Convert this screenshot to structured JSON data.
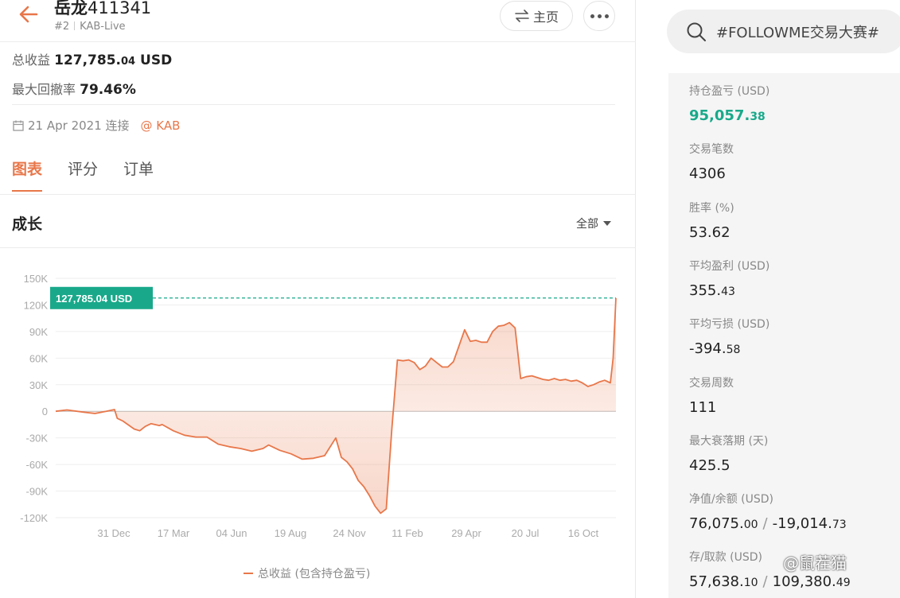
{
  "header": {
    "title_name": "岳龙",
    "title_num": "411341",
    "rank": "#2",
    "account_type": "KAB-Live",
    "home_label": "主页",
    "home_icon": "swap-arrows-icon",
    "more_icon": "more-dots-icon",
    "back_icon": "back-arrow-icon"
  },
  "summary": {
    "total_profit_label": "总收益",
    "total_profit_main": "127,785.",
    "total_profit_decimal": "04",
    "total_profit_unit": "USD",
    "max_drawdown_label": "最大回撤率",
    "max_drawdown_value": "79.46%",
    "connected_date": "21 Apr 2021 连接",
    "broker": "@ KAB",
    "calendar_icon": "calendar-icon"
  },
  "tabs": [
    {
      "label": "图表",
      "active": true
    },
    {
      "label": "评分",
      "active": false
    },
    {
      "label": "订单",
      "active": false
    }
  ],
  "growth": {
    "title": "成长",
    "filter": "全部"
  },
  "chart_data": {
    "type": "area",
    "current_value_label": "127,785.04 USD",
    "current_value": 127785.04,
    "y_ticks": [
      "150K",
      "120K",
      "90K",
      "60K",
      "30K",
      "0",
      "-30K",
      "-60K",
      "-90K",
      "-120K"
    ],
    "y_tick_values": [
      150000,
      120000,
      90000,
      60000,
      30000,
      0,
      -30000,
      -60000,
      -90000,
      -120000
    ],
    "ylim": [
      -120000,
      150000
    ],
    "x_ticks": [
      "31 Dec",
      "17 Mar",
      "04 Jun",
      "19 Aug",
      "24 Nov",
      "11 Feb",
      "29 Apr",
      "20 Jul",
      "16 Oct"
    ],
    "xlim": [
      0,
      100
    ],
    "series": [
      {
        "name": "总收益 (包含持仓盈亏)",
        "color": "#e8774a",
        "x": [
          0,
          2,
          5,
          7,
          9,
          10.5,
          11,
          12,
          14,
          15,
          16,
          17,
          18.5,
          19,
          21,
          23,
          25,
          27,
          29,
          31,
          33,
          35,
          37,
          38,
          40,
          42,
          44,
          46,
          48,
          50,
          51,
          52,
          53,
          54,
          55,
          56,
          57,
          58,
          59,
          60,
          61,
          62,
          63,
          64,
          65,
          66,
          67,
          68,
          69,
          70,
          71,
          72,
          73,
          74,
          75,
          76,
          77,
          78,
          79,
          80,
          81,
          82,
          83,
          84,
          85,
          86,
          87,
          88,
          89,
          90,
          91,
          92,
          93,
          94,
          95,
          96,
          97,
          98,
          99,
          99.5,
          100
        ],
        "y": [
          0,
          1500,
          -1000,
          -2500,
          0,
          2000,
          -8000,
          -11000,
          -20000,
          -22000,
          -17000,
          -14000,
          -16000,
          -15000,
          -22000,
          -27000,
          -29000,
          -29000,
          -37000,
          -40000,
          -42000,
          -45000,
          -42000,
          -38000,
          -44000,
          -48000,
          -54000,
          -53000,
          -50000,
          -30000,
          -52000,
          -57000,
          -65000,
          -78000,
          -85000,
          -95000,
          -107000,
          -115000,
          -110000,
          -20000,
          58000,
          57000,
          58000,
          55000,
          47000,
          51000,
          60000,
          55000,
          50000,
          50000,
          56000,
          74000,
          92000,
          79000,
          80000,
          78000,
          78000,
          90000,
          96000,
          97000,
          100000,
          94000,
          37000,
          39000,
          40000,
          38000,
          36000,
          35000,
          37000,
          35000,
          36000,
          34000,
          35000,
          32000,
          28000,
          30000,
          33000,
          35000,
          32000,
          60000,
          127785
        ]
      }
    ],
    "legend": [
      "总收益 (包含持仓盈亏)"
    ],
    "legend_position": "bottom-center",
    "grid": true
  },
  "search": {
    "placeholder": "#FOLLOWME交易大赛#",
    "icon": "search-icon"
  },
  "stats": [
    {
      "label": "持仓盈亏 (USD)",
      "main": "95,057.",
      "dec": "38",
      "green": true
    },
    {
      "label": "交易笔数",
      "main": "4306",
      "dec": ""
    },
    {
      "label": "胜率 (%)",
      "main": "53.62",
      "dec": ""
    },
    {
      "label": "平均盈利 (USD)",
      "main": "355.",
      "dec": "43"
    },
    {
      "label": "平均亏损 (USD)",
      "main": "-394.",
      "dec": "58"
    },
    {
      "label": "交易周数",
      "main": "111",
      "dec": ""
    },
    {
      "label": "最大衰落期 (天)",
      "main": "425.5",
      "dec": ""
    },
    {
      "label": "净值/余额 (USD)",
      "main": "76,075.",
      "dec": "00",
      "main2": "-19,014.",
      "dec2": "73"
    },
    {
      "label": "存/取款 (USD)",
      "main": "57,638.",
      "dec": "10",
      "main2": "109,380.",
      "dec2": "49"
    }
  ],
  "watermark": "@鼠茬猫",
  "colors": {
    "accent": "#e8774a",
    "green": "#19a98a",
    "panel_bg": "#f5f5f5"
  }
}
